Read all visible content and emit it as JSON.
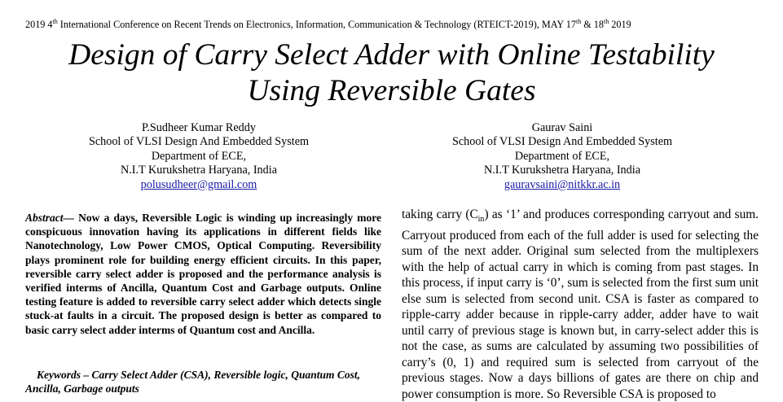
{
  "conference": {
    "year_prefix": "2019 4",
    "ordinal": "th",
    "name": " International Conference on Recent Trends on Electronics, Information, Communication & Technology (RTEICT-2019), MAY 17",
    "date_sup1": "th",
    "date_mid": " & 18",
    "date_sup2": "th",
    "date_end": " 2019"
  },
  "title": {
    "line1": "Design of Carry Select Adder with Online Testability",
    "line2": "Using Reversible Gates"
  },
  "authors": [
    {
      "name": "P.Sudheer Kumar Reddy",
      "school": "School of VLSI Design And Embedded System",
      "department": "Department of ECE,",
      "institute": "N.I.T Kurukshetra Haryana, India",
      "email": "polusudheer@gmail.com"
    },
    {
      "name": "Gaurav Saini",
      "school": "School of VLSI Design And Embedded System",
      "department": "Department of ECE,",
      "institute": "N.I.T Kurukshetra Haryana, India",
      "email": "gauravsaini@nitkkr.ac.in"
    }
  ],
  "abstract": {
    "lead": "Abstract—",
    "body": " Now a days, Reversible Logic is winding up increasingly more conspicuous innovation having its applications in different fields like Nanotechnology, Low Power CMOS, Optical Computing. Reversibility plays prominent role for building energy efficient circuits. In this paper, reversible carry select adder is proposed and the performance analysis is verified interms of Ancilla, Quantum Cost and Garbage outputs. Online testing feature is added to reversible carry select adder which detects single stuck-at faults in a circuit. The proposed design is better as compared to basic carry select adder interms of Quantum cost and Ancilla."
  },
  "keywords": "Keywords – Carry Select Adder (CSA), Reversible logic, Quantum Cost, Ancilla, Garbage outputs",
  "right_column": {
    "pre_sub": "taking carry (C",
    "sub": "in",
    "post_sub": ") as ‘1’ and produces corresponding carryout and sum. Carryout produced from each of the full adder is used for selecting the sum of the next adder. Original sum selected from the multiplexers with the help of actual carry in which is coming from past stages. In this process, if input carry is ‘0’, sum is selected from the first sum unit else sum is selected from second unit. CSA is faster as compared to ripple-carry adder because in ripple-carry adder, adder have to wait until carry of previous stage is known but, in carry-select adder this is not the case, as sums are calculated by assuming two possibilities of carry’s (0, 1) and required sum is selected from carryout of the previous stages. Now a days billions of gates are there on chip and power consumption is more. So Reversible CSA is proposed to"
  }
}
